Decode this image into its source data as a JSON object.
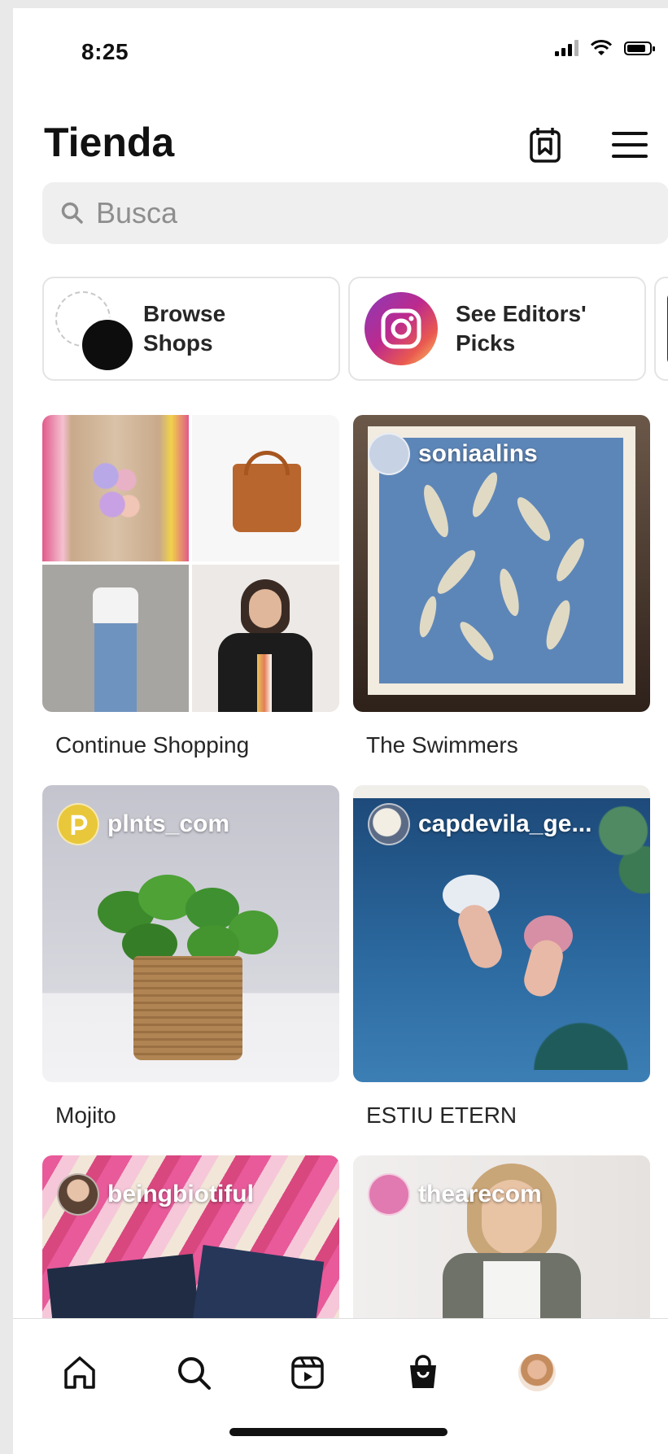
{
  "status_bar": {
    "time": "8:25"
  },
  "header": {
    "title": "Tienda"
  },
  "search": {
    "placeholder": "Busca"
  },
  "chips": [
    {
      "line1": "Browse",
      "line2": "Shops"
    },
    {
      "line1": "See Editors'",
      "line2": "Picks"
    }
  ],
  "cards": [
    {
      "title": "Continue Shopping",
      "user": ""
    },
    {
      "title": "The Swimmers",
      "user": "soniaalins"
    },
    {
      "title": "Mojito",
      "user": "plnts_com"
    },
    {
      "title": "ESTIU ETERN",
      "user": "capdevila_ge..."
    },
    {
      "title": "",
      "user": "beingbiotiful"
    },
    {
      "title": "",
      "user": "thearecom"
    }
  ],
  "tabbar": {
    "items": [
      "home-icon",
      "search-icon",
      "reels-icon",
      "shop-icon",
      "profile-avatar"
    ],
    "active": "shop-icon"
  },
  "colors": {
    "accent": "#262626",
    "search_bg": "#efefef"
  }
}
